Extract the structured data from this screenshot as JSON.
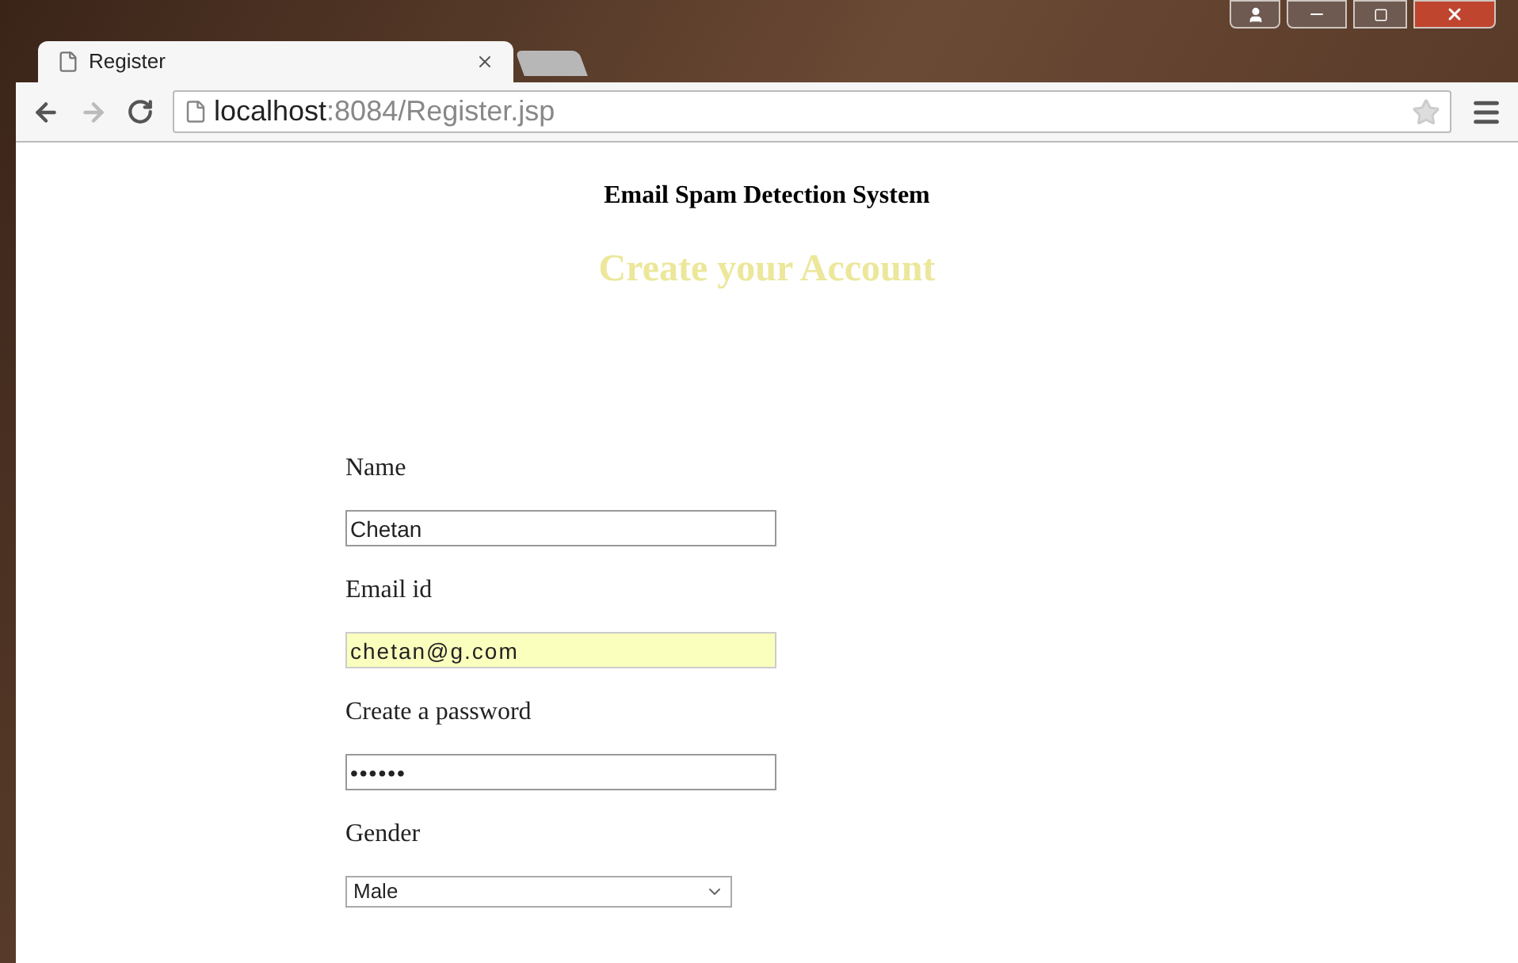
{
  "tabs": [
    {
      "label": "Register",
      "selected": true
    }
  ],
  "address": {
    "host": "localhost",
    "rest": ":8084/Register.jsp"
  },
  "page": {
    "site_title": "Email Spam Detection System",
    "heading": "Create your Account",
    "fields": [
      {
        "kind": "text",
        "label": "Name",
        "value": "Chetan"
      },
      {
        "kind": "text",
        "label": "Email id",
        "value": "chetan@g.com",
        "autofilled": true
      },
      {
        "kind": "password",
        "label": "Create a password",
        "value": "••••••"
      },
      {
        "kind": "select",
        "label": "Gender",
        "value": "Male"
      }
    ]
  }
}
